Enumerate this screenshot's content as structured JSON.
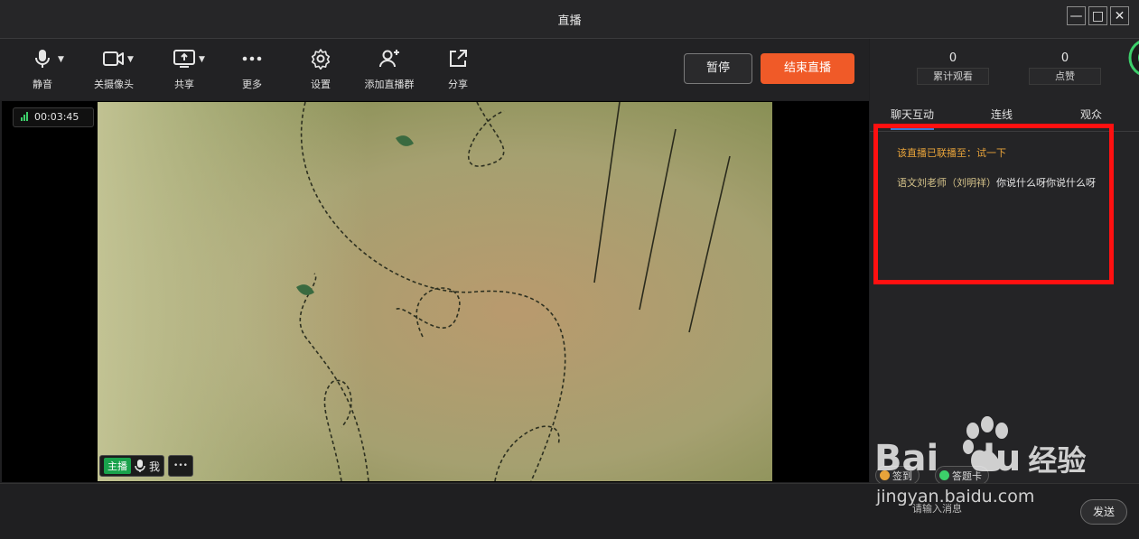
{
  "window": {
    "title": "直播",
    "minimize_glyph": "—",
    "maximize_glyph": "□",
    "close_glyph": "✕"
  },
  "toolbar": {
    "items": [
      {
        "label": "静音",
        "icon": "microphone-icon",
        "has_dropdown": true
      },
      {
        "label": "关摄像头",
        "icon": "camera-icon",
        "has_dropdown": true
      },
      {
        "label": "共享",
        "icon": "screen-share-icon",
        "has_dropdown": true
      },
      {
        "label": "更多",
        "icon": "more-dots-icon",
        "has_dropdown": false
      },
      {
        "label": "设置",
        "icon": "gear-icon",
        "has_dropdown": false
      },
      {
        "label": "添加直播群",
        "icon": "add-group-icon",
        "has_dropdown": false
      },
      {
        "label": "分享",
        "icon": "share-icon",
        "has_dropdown": false
      }
    ],
    "pause_label": "暂停",
    "end_label": "结束直播"
  },
  "stats": {
    "views_value": "0",
    "views_label": "累计观看",
    "likes_value": "0",
    "likes_label": "点赞"
  },
  "video": {
    "timer": "00:03:45",
    "host_tag": "主播",
    "me_label": "我",
    "more_glyph": "•••"
  },
  "panel": {
    "tabs": [
      "聊天互动",
      "连线",
      "观众"
    ],
    "active_tab": 0,
    "messages": [
      {
        "type": "system",
        "text": "该直播已联播至：试一下"
      },
      {
        "type": "chat",
        "name": "语文刘老师（刘明祥）",
        "text": "你说什么呀你说什么呀"
      }
    ],
    "chips": [
      {
        "label": "签到",
        "color": "#e8a33a"
      },
      {
        "label": "答题卡",
        "color": "#3ccf6a"
      }
    ],
    "input_placeholder": "请输入消息",
    "send_label": "发送"
  },
  "watermark": {
    "brand": "Bai",
    "brand_tail": "du",
    "cn": "经验",
    "url": "jingyan.baidu.com"
  },
  "colors": {
    "end_button": "#f05a28",
    "highlight_box": "#ff1010",
    "host_tag": "#19a24c",
    "signal": "#3ccf6a"
  }
}
